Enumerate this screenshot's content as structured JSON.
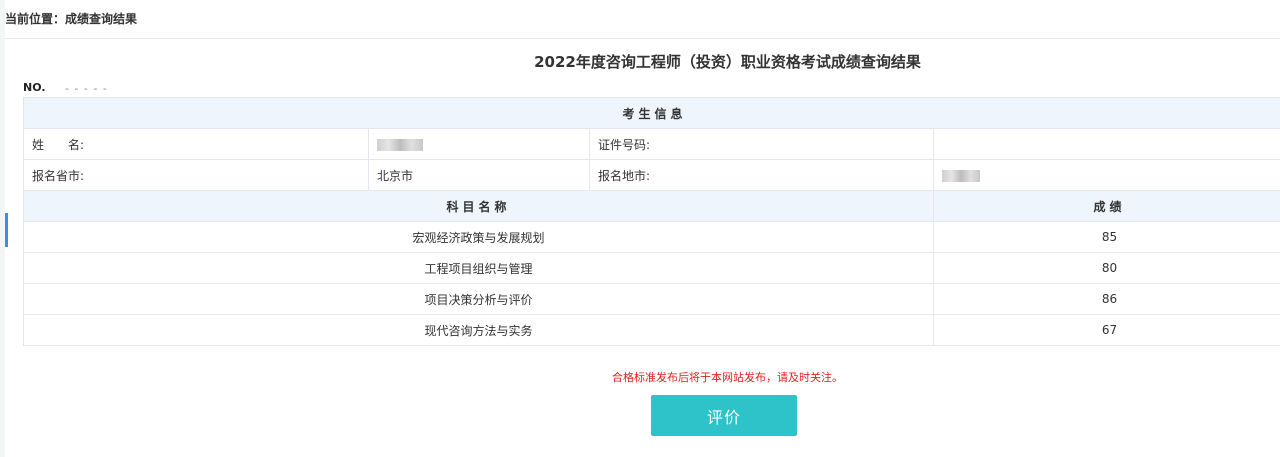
{
  "breadcrumb": {
    "label": "当前位置：",
    "current": "成绩查询结果"
  },
  "title": "2022年度咨询工程师（投资）职业资格考试成绩查询结果",
  "no": {
    "label": "NO.",
    "value": "- - - - -"
  },
  "candidate_section": {
    "header": "考生信息",
    "name_label": "姓　　名:",
    "id_label": "证件号码:",
    "id_value": "",
    "province_label": "报名省市:",
    "province_value": "北京市",
    "city_label": "报名地市:"
  },
  "scores": {
    "subject_header": "科目名称",
    "score_header": "成绩",
    "rows": [
      {
        "subject": "宏观经济政策与发展规划",
        "score": "85"
      },
      {
        "subject": "工程项目组织与管理",
        "score": "80"
      },
      {
        "subject": "项目决策分析与评价",
        "score": "86"
      },
      {
        "subject": "现代咨询方法与实务",
        "score": "67"
      }
    ]
  },
  "notice": "合格标准发布后将于本网站发布，请及时关注。",
  "evaluate_button": "评价",
  "colors": {
    "accent": "#2ec3c8",
    "notice": "#e02020",
    "section_header_bg": "#eef5fd"
  }
}
